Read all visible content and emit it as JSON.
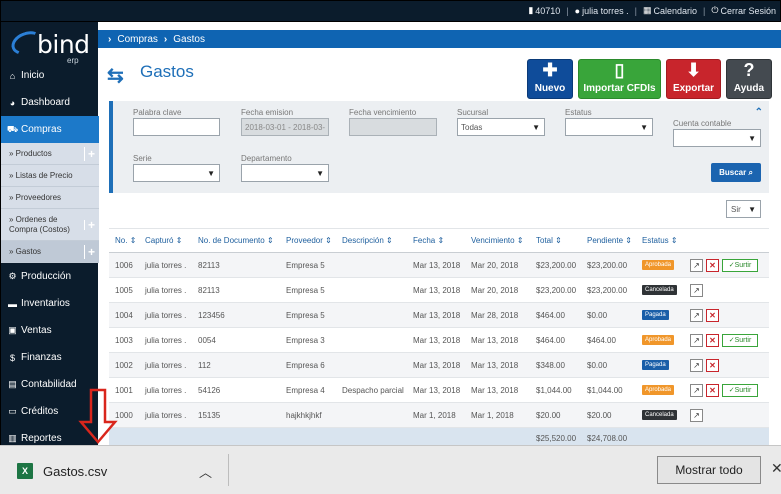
{
  "topbar": {
    "account": "40710",
    "user": "julia torres .",
    "calendar": "Calendario",
    "logout": "Cerrar Sesión"
  },
  "logo": {
    "text": "bind",
    "sub": "erp"
  },
  "sidebar": {
    "items": [
      {
        "label": "Inicio",
        "icon": "home-icon"
      },
      {
        "label": "Dashboard",
        "icon": "dashboard-icon"
      },
      {
        "label": "Compras",
        "icon": "cart-icon"
      },
      {
        "label": "Producción",
        "icon": "production-icon"
      },
      {
        "label": "Inventarios",
        "icon": "truck-icon"
      },
      {
        "label": "Ventas",
        "icon": "sales-icon"
      },
      {
        "label": "Finanzas",
        "icon": "dollar-icon"
      },
      {
        "label": "Contabilidad",
        "icon": "accounting-icon"
      },
      {
        "label": "Créditos",
        "icon": "credit-icon"
      },
      {
        "label": "Reportes",
        "icon": "chart-icon"
      }
    ],
    "compras_sub": [
      {
        "label": "» Productos",
        "plus": "+"
      },
      {
        "label": "» Listas de Precio",
        "plus": ""
      },
      {
        "label": "» Proveedores",
        "plus": ""
      },
      {
        "label": "» Ordenes de Compra (Costos)",
        "plus": "+"
      },
      {
        "label": "» Gastos",
        "plus": "+"
      }
    ]
  },
  "breadcrumb": {
    "items": [
      "Compras",
      "Gastos"
    ]
  },
  "page": {
    "title": "Gastos"
  },
  "header_buttons": {
    "nuevo": "Nuevo",
    "importar": "Importar CFDIs",
    "exportar": "Exportar",
    "ayuda": "Ayuda"
  },
  "filters": {
    "palabra_clave": {
      "label": "Palabra clave",
      "value": ""
    },
    "fecha_emision": {
      "label": "Fecha emision",
      "value": "2018-03-01 - 2018-03-"
    },
    "fecha_vencimiento": {
      "label": "Fecha vencimiento",
      "value": ""
    },
    "sucursal": {
      "label": "Sucursal",
      "value": "Todas"
    },
    "estatus": {
      "label": "Estatus",
      "value": ""
    },
    "cuenta_contable": {
      "label": "Cuenta contable",
      "value": ""
    },
    "serie": {
      "label": "Serie",
      "value": ""
    },
    "departamento": {
      "label": "Departamento",
      "value": ""
    },
    "buscar": "Buscar"
  },
  "sir_select": "Sir",
  "table": {
    "headers": [
      "No.",
      "Capturó",
      "No. de Documento",
      "Proveedor",
      "Descripción",
      "Fecha",
      "Vencimiento",
      "Total",
      "Pendiente",
      "Estatus"
    ],
    "rows": [
      {
        "no": "1006",
        "capturo": "julia torres .",
        "doc": "82113",
        "proveedor": "Empresa 5",
        "descripcion": "",
        "fecha": "Mar 13, 2018",
        "vencimiento": "Mar 20, 2018",
        "total": "$23,200.00",
        "pendiente": "$23,200.00",
        "estatus": "Aprobada",
        "status_class": "aprobada",
        "surtir": "Surtir",
        "del": true
      },
      {
        "no": "1005",
        "capturo": "julia torres .",
        "doc": "82113",
        "proveedor": "Empresa 5",
        "descripcion": "",
        "fecha": "Mar 13, 2018",
        "vencimiento": "Mar 20, 2018",
        "total": "$23,200.00",
        "pendiente": "$23,200.00",
        "estatus": "Cancelada",
        "status_class": "cancelada",
        "surtir": "",
        "del": false
      },
      {
        "no": "1004",
        "capturo": "julia torres .",
        "doc": "123456",
        "proveedor": "Empresa 5",
        "descripcion": "",
        "fecha": "Mar 13, 2018",
        "vencimiento": "Mar 28, 2018",
        "total": "$464.00",
        "pendiente": "$0.00",
        "estatus": "Pagada",
        "status_class": "pagada",
        "surtir": "",
        "del": true
      },
      {
        "no": "1003",
        "capturo": "julia torres .",
        "doc": "0054",
        "proveedor": "Empresa 3",
        "descripcion": "",
        "fecha": "Mar 13, 2018",
        "vencimiento": "Mar 13, 2018",
        "total": "$464.00",
        "pendiente": "$464.00",
        "estatus": "Aprobada",
        "status_class": "aprobada",
        "surtir": "Surtir",
        "del": true
      },
      {
        "no": "1002",
        "capturo": "julia torres .",
        "doc": "112",
        "proveedor": "Empresa 6",
        "descripcion": "",
        "fecha": "Mar 13, 2018",
        "vencimiento": "Mar 13, 2018",
        "total": "$348.00",
        "pendiente": "$0.00",
        "estatus": "Pagada",
        "status_class": "pagada",
        "surtir": "",
        "del": true
      },
      {
        "no": "1001",
        "capturo": "julia torres .",
        "doc": "54126",
        "proveedor": "Empresa 4",
        "descripcion": "Despacho parcial",
        "fecha": "Mar 13, 2018",
        "vencimiento": "Mar 13, 2018",
        "total": "$1,044.00",
        "pendiente": "$1,044.00",
        "estatus": "Aprobada",
        "status_class": "aprobada",
        "surtir": "Surtir",
        "del": true
      },
      {
        "no": "1000",
        "capturo": "julia torres .",
        "doc": "15135",
        "proveedor": "hajkhkjhkf",
        "descripcion": "",
        "fecha": "Mar 1, 2018",
        "vencimiento": "Mar 1, 2018",
        "total": "$20.00",
        "pendiente": "$20.00",
        "estatus": "Cancelada",
        "status_class": "cancelada",
        "surtir": "",
        "del": false
      }
    ],
    "totals": {
      "total": "$25,520.00",
      "pendiente": "$24,708.00"
    }
  },
  "download_bar": {
    "file_name": "Gastos.csv",
    "file_icon": "excel-icon",
    "show_all": "Mostrar todo"
  },
  "colors": {
    "nav_dark": "#0b1c2c",
    "accent_blue": "#1c79c9",
    "aprobada": "#f0962a",
    "cancelada": "#2f3336",
    "pagada": "#1a5ea8",
    "annotation_arrow": "#d9261c"
  }
}
